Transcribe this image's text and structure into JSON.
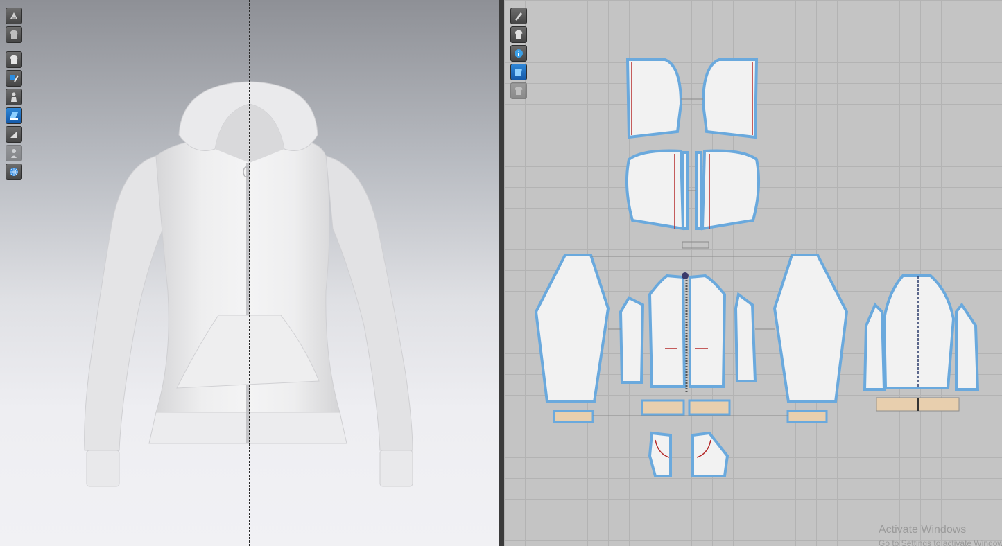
{
  "app": {
    "panes": [
      "3D Garment Window",
      "2D Pattern Window"
    ]
  },
  "toolbar3d": {
    "tools": [
      {
        "icon": "simulation-icon",
        "active": false
      },
      {
        "icon": "garment-quality-icon",
        "active": false
      },
      {
        "icon": "show-garment-icon",
        "active": false
      },
      {
        "icon": "texture-brush-icon",
        "active": false
      },
      {
        "icon": "avatar-icon",
        "active": false
      },
      {
        "icon": "fabric-surface-icon",
        "active": true
      },
      {
        "icon": "fold-arrangement-icon",
        "active": false
      },
      {
        "icon": "avatar-silhouette-icon",
        "active": false,
        "disabled": true
      },
      {
        "icon": "globe-icon",
        "active": false
      }
    ]
  },
  "toolbar2d": {
    "tools": [
      {
        "icon": "pen-tool-icon",
        "active": false
      },
      {
        "icon": "garment-view-icon",
        "active": false
      },
      {
        "icon": "info-icon",
        "active": false
      },
      {
        "icon": "fabric-pattern-icon",
        "active": true
      },
      {
        "icon": "locked-garment-icon",
        "active": false,
        "disabled": true
      }
    ]
  },
  "colors": {
    "outline": "#6aa9dd",
    "piece_fill": "#f2f2f2",
    "rib_fill": "#e8cfae",
    "seam_red": "#b52a2a",
    "grid_bg": "#c4c4c4"
  },
  "watermark": {
    "title": "Activate Windows",
    "subtitle": "Go to Settings to activate Windows."
  }
}
